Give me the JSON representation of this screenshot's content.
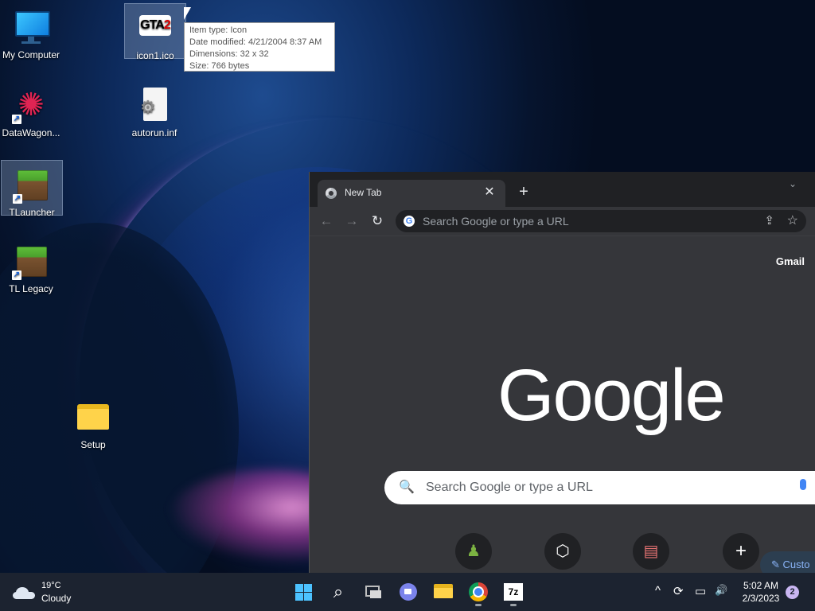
{
  "desktop": {
    "icons": [
      {
        "label": "My Computer"
      },
      {
        "label": "DataWagon..."
      },
      {
        "label": "TLauncher"
      },
      {
        "label": "TL Legacy"
      },
      {
        "label": "icon1.ico",
        "glyph_text": "GTA",
        "glyph_num": "2"
      },
      {
        "label": "autorun.inf"
      },
      {
        "label": "Setup"
      }
    ],
    "tooltip": {
      "line1": "Item type: Icon",
      "line2": "Date modified: 4/21/2004 8:37 AM",
      "line3": "Dimensions: 32 x 32",
      "line4": "Size: 766 bytes"
    }
  },
  "browser": {
    "tab_title": "New Tab",
    "tab_close": "✕",
    "new_tab": "+",
    "tab_search": "⌄",
    "nav_back": "←",
    "nav_forward": "→",
    "nav_reload": "↻",
    "omnibox_placeholder": "Search Google or type a URL",
    "share_glyph": "⇪",
    "star_glyph": "☆",
    "gmail_link": "Gmail",
    "logo": "Google",
    "search_placeholder": "Search Google or type a URL",
    "search_glyph": "🔍",
    "shortcuts": [
      {
        "name": "chess",
        "glyph": "♟"
      },
      {
        "name": "cube",
        "glyph": "⬡"
      },
      {
        "name": "store",
        "glyph": "▤"
      },
      {
        "name": "add",
        "glyph": "+"
      }
    ],
    "customize": "✎ Custo"
  },
  "taskbar": {
    "weather_temp": "19°C",
    "weather_cond": "Cloudy",
    "tray_chevron": "^",
    "tray_sync": "⟳",
    "tray_network": "▭",
    "tray_volume": "🔊",
    "time": "5:02 AM",
    "date": "2/3/2023",
    "notifications": "2",
    "seven_zip": "7z"
  },
  "colors": {
    "accent": "#4cc2ff",
    "chrome_bg": "#35363a",
    "taskbar_bg": "#1c2330"
  }
}
